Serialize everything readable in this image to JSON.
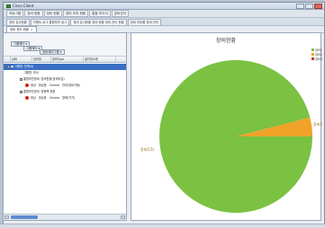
{
  "window": {
    "title": "Cisco Client"
  },
  "menubar": {
    "items": [
      "프로그램",
      "장비 현황",
      "장비 현황",
      "장비 조치 현황",
      "통합 보고서",
      "장비관리"
    ]
  },
  "tabs": [
    "장비 유사현황",
    "이벤트 로그 통합보안 로그",
    "장비 유사현황 장비 현황 장비 관리 현황",
    "장비 컨트롤 장비 관리"
  ],
  "subtab": {
    "label": "장비 관리 현황",
    "close": "×"
  },
  "left": {
    "group_chips": [
      "그룹헤더 ▾",
      "그룹헤더 ▾",
      "장비에러그룹 ▾"
    ],
    "columns": [
      "",
      "상태",
      "장비명",
      "장비Type",
      "설치장소명"
    ],
    "rows": [
      {
        "text": "▣ 그룹명: 전체(4)",
        "selected": true
      },
      {
        "text": "그룹명: 부서",
        "selected": false
      },
      {
        "text": "통합보안장비: 장비현황(장비타입)",
        "selected": false
      },
      {
        "cells": [
          "정상",
          "정상동",
          "Cenoro",
          "관리(장비가동)"
        ],
        "selected": false
      },
      {
        "text": "통합보안장비: 방화벽 현황",
        "selected": false
      },
      {
        "cells": [
          "정상",
          "정상동",
          "Cenoro",
          "방화(기가)"
        ],
        "selected": false
      }
    ]
  },
  "chart_data": {
    "type": "pie",
    "title": "장비현황",
    "slices": [
      {
        "label": "장비1",
        "value": 96,
        "color": "#7bc142"
      },
      {
        "label": "장비2",
        "value": 4,
        "color": "#f0a229"
      },
      {
        "label": "장비3",
        "value": 0,
        "color": "#c0392b"
      }
    ],
    "data_labels": [
      "장비1(1)",
      "장비2(1)"
    ],
    "legend_position": "top-right"
  }
}
